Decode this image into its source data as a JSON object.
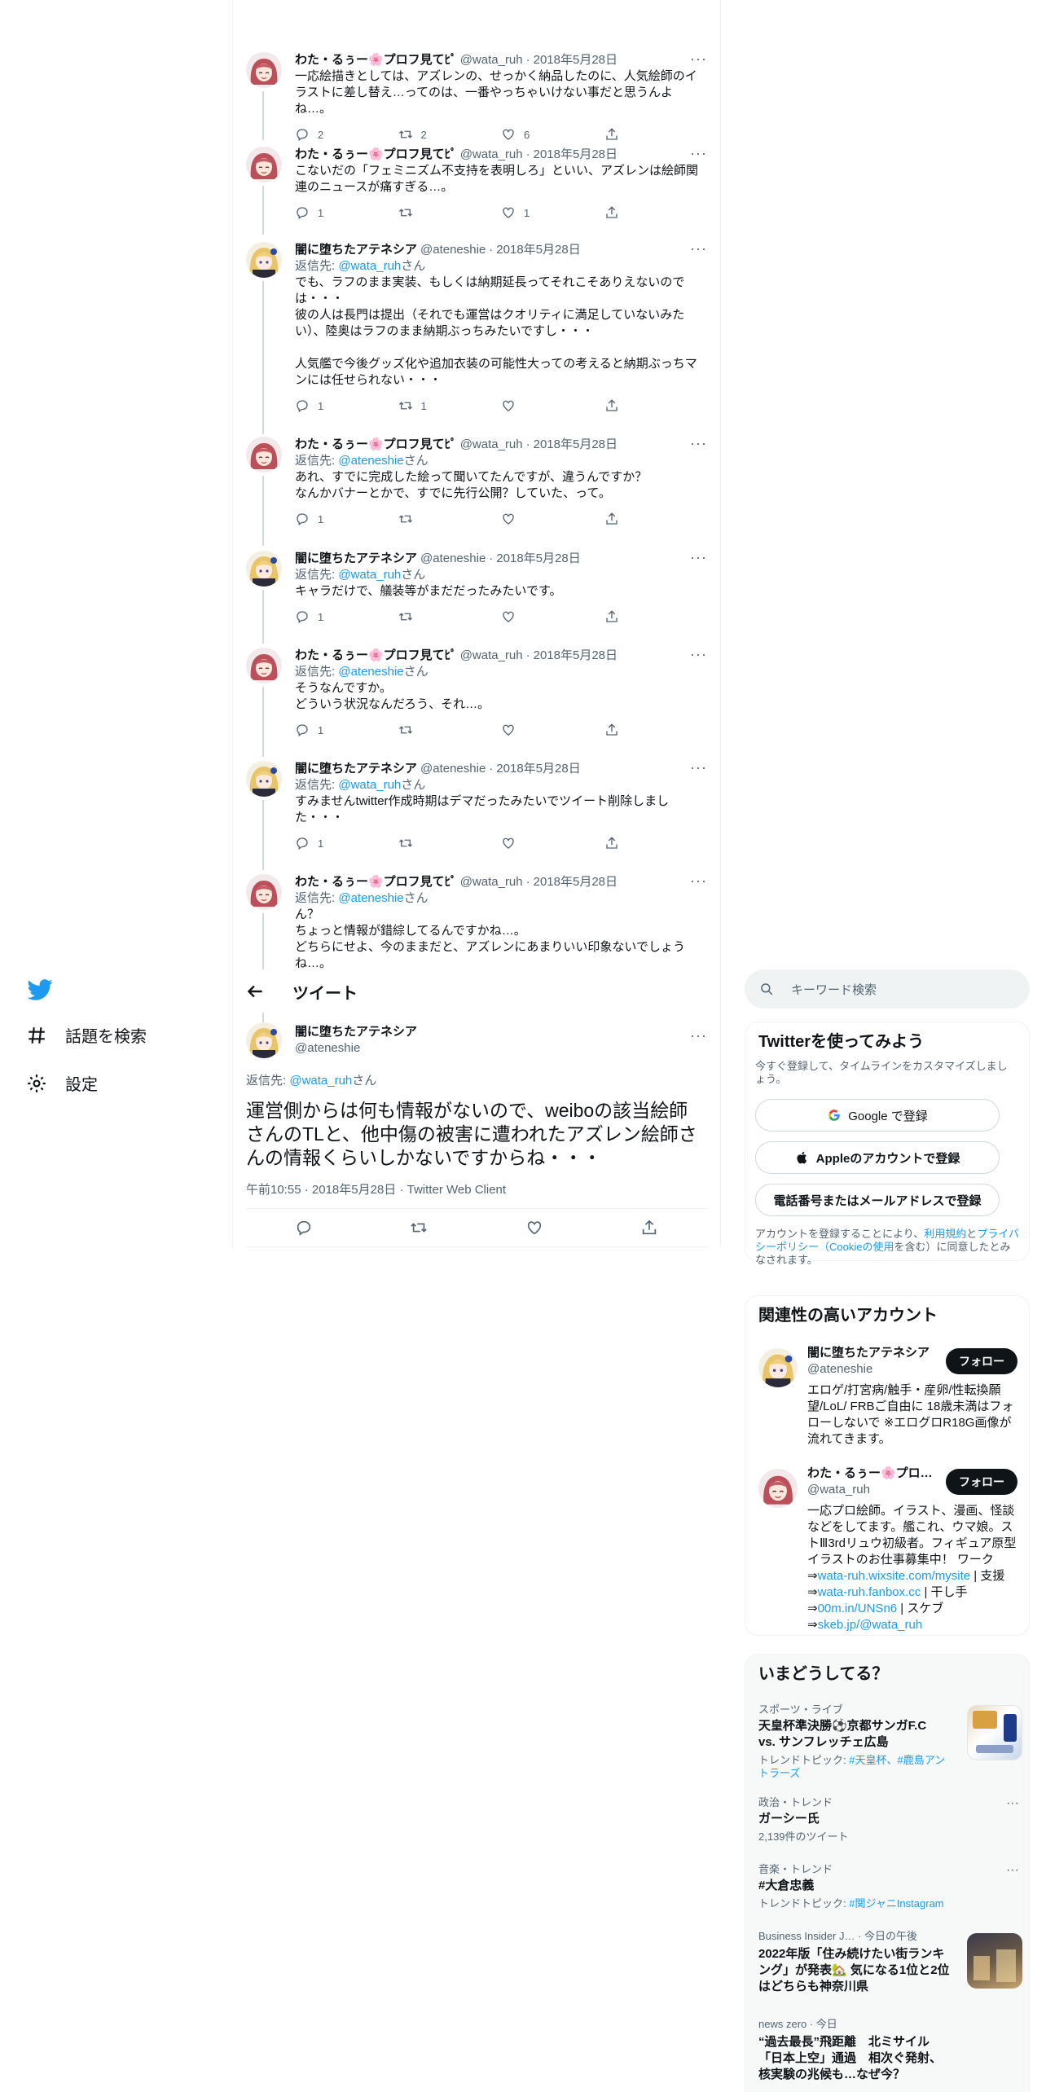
{
  "nav": {
    "explore_label": "話題を検索",
    "settings_label": "設定"
  },
  "thread": [
    {
      "author": "わた・るぅー🌸プロフ見てﾋﾟ",
      "handle": "@wata_ruh",
      "date": "2018年5月28日",
      "avatar": "pink",
      "reply_prefix": "",
      "reply_user": "",
      "reply_suffix": "",
      "text": "一応絵描きとしては、アズレンの、せっかく納品したのに、人気絵師のイラストに差し替え…ってのは、一番やっちゃいけない事だと思うんよね…。",
      "replies": "2",
      "retweets": "2",
      "likes": "6"
    },
    {
      "author": "わた・るぅー🌸プロフ見てﾋﾟ",
      "handle": "@wata_ruh",
      "date": "2018年5月28日",
      "avatar": "pink",
      "reply_prefix": "",
      "reply_user": "",
      "reply_suffix": "",
      "text": "こないだの「フェミニズム不支持を表明しろ」といい、アズレンは絵師関連のニュースが痛すぎる…。",
      "replies": "1",
      "retweets": "",
      "likes": "1"
    },
    {
      "author": "闇に堕ちたアテネシア",
      "handle": "@ateneshie",
      "date": "2018年5月28日",
      "avatar": "blonde",
      "reply_prefix": "返信先: ",
      "reply_user": "@wata_ruh",
      "reply_suffix": "さん",
      "text": "でも、ラフのまま実装、もしくは納期延長ってそれこそありえないのでは・・・\n彼の人は長門は提出（それでも運営はクオリティに満足していないみたい）、陸奥はラフのまま納期ぶっちみたいですし・・・\n\n人気艦で今後グッズ化や追加衣装の可能性大っての考えると納期ぶっちマンには任せられない・・・",
      "replies": "1",
      "retweets": "1",
      "likes": ""
    },
    {
      "author": "わた・るぅー🌸プロフ見てﾋﾟ",
      "handle": "@wata_ruh",
      "date": "2018年5月28日",
      "avatar": "pink",
      "reply_prefix": "返信先: ",
      "reply_user": "@ateneshie",
      "reply_suffix": "さん",
      "text": "あれ、すでに完成した絵って聞いてたんですが、違うんですか？\nなんかバナーとかで、すでに先行公開？していた、って。",
      "replies": "1",
      "retweets": "",
      "likes": ""
    },
    {
      "author": "闇に堕ちたアテネシア",
      "handle": "@ateneshie",
      "date": "2018年5月28日",
      "avatar": "blonde",
      "reply_prefix": "返信先: ",
      "reply_user": "@wata_ruh",
      "reply_suffix": "さん",
      "text": "キャラだけで、艤装等がまだだったみたいです。",
      "replies": "1",
      "retweets": "",
      "likes": ""
    },
    {
      "author": "わた・るぅー🌸プロフ見てﾋﾟ",
      "handle": "@wata_ruh",
      "date": "2018年5月28日",
      "avatar": "pink",
      "reply_prefix": "返信先: ",
      "reply_user": "@ateneshie",
      "reply_suffix": "さん",
      "text": "そうなんですか。\nどういう状況なんだろう、それ…。",
      "replies": "1",
      "retweets": "",
      "likes": ""
    },
    {
      "author": "闇に堕ちたアテネシア",
      "handle": "@ateneshie",
      "date": "2018年5月28日",
      "avatar": "blonde",
      "reply_prefix": "返信先: ",
      "reply_user": "@wata_ruh",
      "reply_suffix": "さん",
      "text": "すみませんtwitter作成時期はデマだったみたいでツイート削除しました・・・",
      "replies": "1",
      "retweets": "",
      "likes": ""
    },
    {
      "author": "わた・るぅー🌸プロフ見てﾋﾟ",
      "handle": "@wata_ruh",
      "date": "2018年5月28日",
      "avatar": "pink",
      "reply_prefix": "返信先: ",
      "reply_user": "@ateneshie",
      "reply_suffix": "さん",
      "text": "ん？\nちょっと情報が錯綜してるんですかね…。\nどちらにせよ、今のままだと、アズレンにあまりいい印象ないでしょうね…。",
      "replies": "",
      "retweets": "",
      "likes": ""
    }
  ],
  "header": {
    "title": "ツイート"
  },
  "main_tweet": {
    "author": "闇に堕ちたアテネシア",
    "handle": "@ateneshie",
    "reply_prefix": "返信先: ",
    "reply_user": "@wata_ruh",
    "reply_suffix": "さん",
    "text": "運営側からは何も情報がないので、weiboの該当絵師さんのTLと、他中傷の被害に遭われたアズレン絵師さんの情報くらいしかないですからね・・・",
    "time": "午前10:55",
    "date": "2018年5月28日",
    "client": "Twitter Web Client"
  },
  "search": {
    "placeholder": "キーワード検索"
  },
  "signup": {
    "title": "Twitterを使ってみよう",
    "subtitle": "今すぐ登録して、タイムラインをカスタマイズしましょう。",
    "google": "Google で登録",
    "apple": "Appleのアカウントで登録",
    "phone": "電話番号またはメールアドレスで登録",
    "terms_1": "アカウントを登録することにより、",
    "terms_link1": "利用規約",
    "terms_2": "と",
    "terms_link2": "プライバシーポリシー（Cookieの使用",
    "terms_3": "を含む）に同意したとみなされます。"
  },
  "relevant": {
    "title": "関連性の高いアカウント",
    "follow_label": "フォロー",
    "accounts": [
      {
        "name": "闇に堕ちたアテネシア",
        "handle": "@ateneshie",
        "bio": "エロゲ/打宮病/触手・産卵/性転換願望/LoL/ FRBご自由に 18歳未満はフォローしないで ※エログロR18G画像が流れてきます。"
      },
      {
        "name": "わた・るぅー🌸プロ…",
        "handle": "@wata_ruh",
        "bio": "一応プロ絵師。イラスト、漫画、怪談などをしてます。艦これ、ウマ娘。ストⅢ3rdリュウ初級者。フィギュア原型イラストのお仕事募集中！ ワーク⇒",
        "link1": "wata-ruh.wixsite.com/mysite",
        "bio2": " | 支援⇒",
        "link2": "wata-ruh.fanbox.cc",
        "bio3": " | 干し手⇒",
        "link3": "00m.in/UNSn6",
        "bio4": " | スケブ⇒",
        "link4": "skeb.jp/@wata_ruh"
      }
    ]
  },
  "trends": {
    "title": "いまどうしてる？",
    "items": [
      {
        "context": "スポーツ・ライブ",
        "title": "天皇杯準決勝⚽京都サンガF.C vs. サンフレッチェ広島",
        "sub_prefix": "トレンドトピック: ",
        "sub_link": "#天皇杯、#鹿島アントラーズ"
      },
      {
        "context": "政治・トレンド",
        "title": "ガーシー氏",
        "sub_prefix": "2,139件のツイート",
        "sub_link": ""
      },
      {
        "context": "音楽・トレンド",
        "title": "#大倉忠義",
        "sub_prefix": "トレンドトピック: ",
        "sub_link": "#関ジャニInstagram"
      },
      {
        "context": "Business Insider J… · 今日の午後",
        "title": "2022年版「住み続けたい街ランキング」が発表🏡 気になる1位と2位はどちらも神奈川県",
        "sub_prefix": "",
        "sub_link": ""
      },
      {
        "context": "news zero · 今日",
        "title": "“過去最長”飛距離　北ミサイル「日本上空」通過　相次ぐ発射、核実験の兆候も…なぜ今？",
        "sub_prefix": "",
        "sub_link": ""
      }
    ]
  },
  "colors": {
    "accent": "#1d9bf0",
    "text": "#0f1419",
    "muted": "#536471",
    "border": "#eff3f4"
  }
}
